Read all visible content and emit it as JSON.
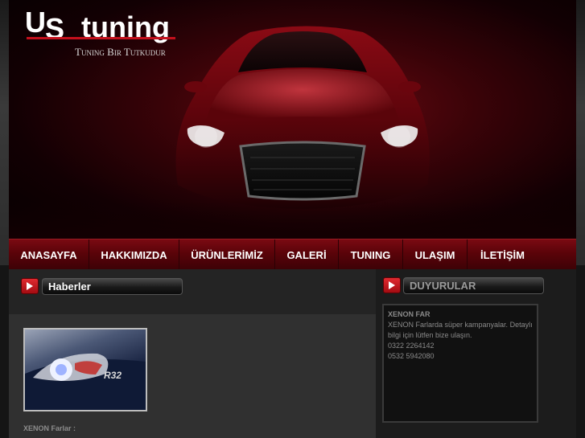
{
  "logo": {
    "us": "U",
    "us_s": "S",
    "tuning": "tuning",
    "slogan": "Tuning Bir Tutkudur"
  },
  "nav": [
    {
      "label": "ANASAYFA"
    },
    {
      "label": "HAKKIMIZDA"
    },
    {
      "label": "ÜRÜNLERİMİZ"
    },
    {
      "label": "GALERİ"
    },
    {
      "label": "TUNING"
    },
    {
      "label": "ULAŞIM"
    },
    {
      "label": "İLETİŞİM"
    }
  ],
  "news": {
    "title": "Haberler",
    "image_label": "R32",
    "caption": "XENON Farlar :"
  },
  "announcements": {
    "title": "DUYURULAR",
    "item_title": "XENON FAR",
    "lines": [
      "XENON Farlarda süper kampanyalar. Detaylı",
      "bilgi için lütfen bize ulaşın.",
      "0322 2264142",
      "0532 5942080"
    ]
  },
  "colors": {
    "accent": "#c4101c",
    "nav_bg": "#5a0309",
    "text_muted": "#8a8a8a"
  },
  "icons": [
    "play-arrow-icon",
    "car-image"
  ]
}
